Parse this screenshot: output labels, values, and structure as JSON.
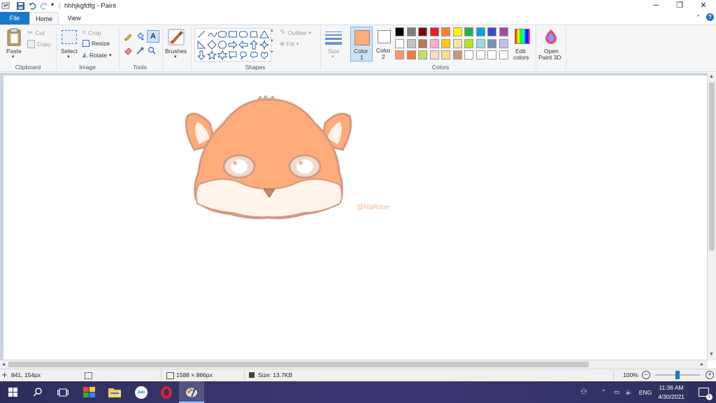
{
  "window": {
    "title": "hhhjkgfdfg - Paint",
    "separator": "|",
    "controls": {
      "minimize": "─",
      "maximize": "❐",
      "close": "✕"
    }
  },
  "tabs": [
    {
      "label": "File"
    },
    {
      "label": "Home"
    },
    {
      "label": "View"
    }
  ],
  "ribbon": {
    "clipboard": {
      "paste": "Paste",
      "cut": "Cut",
      "copy": "Copy",
      "group": "Clipboard"
    },
    "image": {
      "select": "Select",
      "crop": "Crop",
      "resize": "Resize",
      "rotate": "Rotate",
      "group": "Image"
    },
    "tools": {
      "group": "Tools"
    },
    "brushes": {
      "label": "Brushes"
    },
    "shapes": {
      "outline": "Outline",
      "fill": "Fill",
      "group": "Shapes"
    },
    "size": {
      "label": "Size"
    },
    "color1": {
      "label": "Color",
      "num": "1",
      "value": "#ffab7a"
    },
    "color2": {
      "label": "Color",
      "num": "2",
      "value": "#ffffff"
    },
    "colors": {
      "group": "Colors",
      "row1": [
        "#000000",
        "#7f7f7f",
        "#880015",
        "#ed1c24",
        "#ff7f27",
        "#fff200",
        "#22b14c",
        "#00a2e8",
        "#3f48cc",
        "#a349a4"
      ],
      "row2": [
        "#ffffff",
        "#c3c3c3",
        "#b97a57",
        "#ffaec9",
        "#ffc90e",
        "#efe4b0",
        "#b5e61d",
        "#99d9ea",
        "#7092be",
        "#c8bfe7"
      ],
      "row3": [
        "#f79a64",
        "#ef7a38",
        "#b9e65c",
        "#fcd9c4",
        "#f7e086",
        "#c8967a",
        "#ffffff",
        "#ffffff",
        "#ffffff",
        "#ffffff"
      ]
    },
    "edit_colors": {
      "line1": "Edit",
      "line2": "colors"
    },
    "paint3d": {
      "line1": "Open",
      "line2": "Paint 3D"
    }
  },
  "canvas": {
    "watermark": "@NaRone"
  },
  "statusbar": {
    "cursor": "841, 154px",
    "image_size": "1588 × 866px",
    "file_size": "Size: 13.7KB",
    "zoom": "100%",
    "zoom_level": 1.0
  },
  "taskbar": {
    "lang": "ENG",
    "time": "11:36 AM",
    "date": "4/30/2021",
    "notifications": "1",
    "apps": [
      "start",
      "search",
      "task-view",
      "paint-palette",
      "file-explorer",
      "zalo",
      "opera",
      "paint"
    ],
    "zalo_label": "Zalo"
  }
}
